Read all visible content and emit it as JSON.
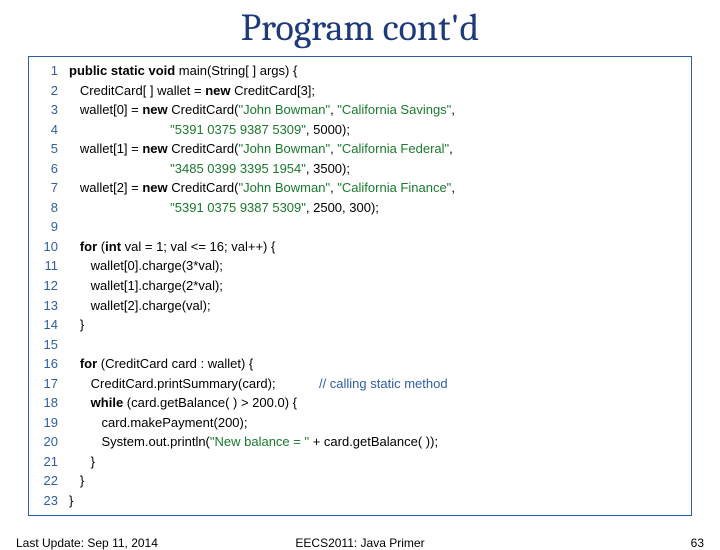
{
  "title": "Program cont'd",
  "code": {
    "lines": [
      {
        "n": 1,
        "indent": 0,
        "segments": [
          {
            "t": "public static void",
            "c": "kw"
          },
          {
            "t": " main(String[ ] args) {"
          }
        ]
      },
      {
        "n": 2,
        "indent": 1,
        "segments": [
          {
            "t": "CreditCard[ ] wallet = "
          },
          {
            "t": "new",
            "c": "kw"
          },
          {
            "t": " CreditCard[3];"
          }
        ]
      },
      {
        "n": 3,
        "indent": 1,
        "segments": [
          {
            "t": "wallet[0] = "
          },
          {
            "t": "new",
            "c": "kw"
          },
          {
            "t": " CreditCard("
          },
          {
            "t": "\"John Bowman\"",
            "c": "str"
          },
          {
            "t": ", "
          },
          {
            "t": "\"California Savings\"",
            "c": "str"
          },
          {
            "t": ","
          }
        ]
      },
      {
        "n": 4,
        "indent": 1,
        "segments": [
          {
            "t": "                         "
          },
          {
            "t": "\"5391 0375 9387 5309\"",
            "c": "str"
          },
          {
            "t": ", 5000);"
          }
        ]
      },
      {
        "n": 5,
        "indent": 1,
        "segments": [
          {
            "t": "wallet[1] = "
          },
          {
            "t": "new",
            "c": "kw"
          },
          {
            "t": " CreditCard("
          },
          {
            "t": "\"John Bowman\"",
            "c": "str"
          },
          {
            "t": ", "
          },
          {
            "t": "\"California Federal\"",
            "c": "str"
          },
          {
            "t": ","
          }
        ]
      },
      {
        "n": 6,
        "indent": 1,
        "segments": [
          {
            "t": "                         "
          },
          {
            "t": "\"3485 0399 3395 1954\"",
            "c": "str"
          },
          {
            "t": ", 3500);"
          }
        ]
      },
      {
        "n": 7,
        "indent": 1,
        "segments": [
          {
            "t": "wallet[2] = "
          },
          {
            "t": "new",
            "c": "kw"
          },
          {
            "t": " CreditCard("
          },
          {
            "t": "\"John Bowman\"",
            "c": "str"
          },
          {
            "t": ", "
          },
          {
            "t": "\"California Finance\"",
            "c": "str"
          },
          {
            "t": ","
          }
        ]
      },
      {
        "n": 8,
        "indent": 1,
        "segments": [
          {
            "t": "                         "
          },
          {
            "t": "\"5391 0375 9387 5309\"",
            "c": "str"
          },
          {
            "t": ", 2500, 300);"
          }
        ]
      },
      {
        "n": 9,
        "indent": 0,
        "segments": [
          {
            "t": ""
          }
        ]
      },
      {
        "n": 10,
        "indent": 1,
        "segments": [
          {
            "t": "for",
            "c": "kw"
          },
          {
            "t": " ("
          },
          {
            "t": "int",
            "c": "kw"
          },
          {
            "t": " val = 1; val <= 16; val++) {"
          }
        ]
      },
      {
        "n": 11,
        "indent": 2,
        "segments": [
          {
            "t": "wallet[0].charge(3*val);"
          }
        ]
      },
      {
        "n": 12,
        "indent": 2,
        "segments": [
          {
            "t": "wallet[1].charge(2*val);"
          }
        ]
      },
      {
        "n": 13,
        "indent": 2,
        "segments": [
          {
            "t": "wallet[2].charge(val);"
          }
        ]
      },
      {
        "n": 14,
        "indent": 1,
        "segments": [
          {
            "t": "}"
          }
        ]
      },
      {
        "n": 15,
        "indent": 0,
        "segments": [
          {
            "t": ""
          }
        ]
      },
      {
        "n": 16,
        "indent": 1,
        "segments": [
          {
            "t": "for",
            "c": "kw"
          },
          {
            "t": " (CreditCard card : wallet) {"
          }
        ]
      },
      {
        "n": 17,
        "indent": 2,
        "segments": [
          {
            "t": "CreditCard.printSummary(card);            "
          },
          {
            "t": "// calling static method",
            "c": "cmt"
          }
        ]
      },
      {
        "n": 18,
        "indent": 2,
        "segments": [
          {
            "t": "while",
            "c": "kw"
          },
          {
            "t": " (card.getBalance( ) > 200.0) {"
          }
        ]
      },
      {
        "n": 19,
        "indent": 3,
        "segments": [
          {
            "t": "card.makePayment(200);"
          }
        ]
      },
      {
        "n": 20,
        "indent": 3,
        "segments": [
          {
            "t": "System.out.println("
          },
          {
            "t": "\"New balance = \"",
            "c": "str"
          },
          {
            "t": " + card.getBalance( ));"
          }
        ]
      },
      {
        "n": 21,
        "indent": 2,
        "segments": [
          {
            "t": "}"
          }
        ]
      },
      {
        "n": 22,
        "indent": 1,
        "segments": [
          {
            "t": "}"
          }
        ]
      },
      {
        "n": 23,
        "indent": 0,
        "segments": [
          {
            "t": "}"
          }
        ]
      }
    ]
  },
  "footer": {
    "left": "Last Update: Sep 11, 2014",
    "center": "EECS2011: Java Primer",
    "right": "63"
  }
}
